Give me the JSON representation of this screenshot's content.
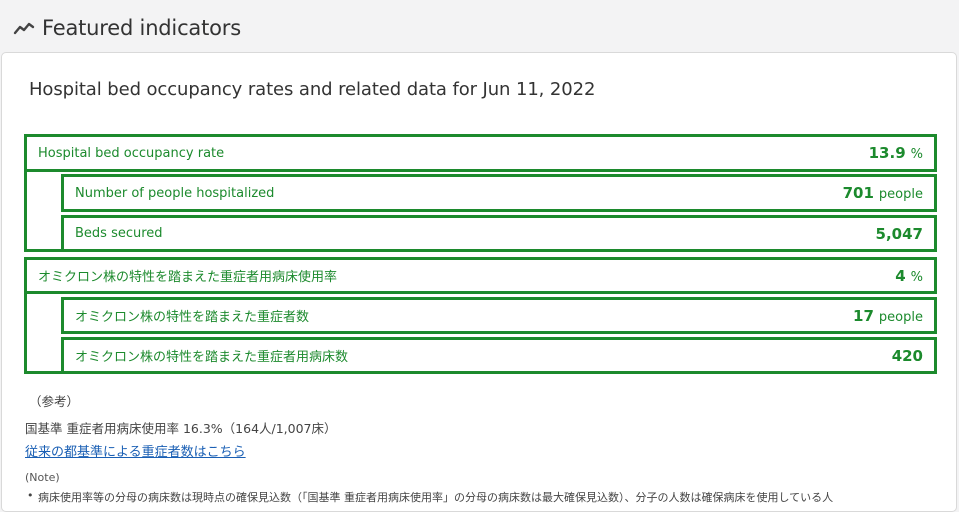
{
  "header": {
    "title": "Featured indicators",
    "icon": "trend-line-icon"
  },
  "card": {
    "title": "Hospital bed occupancy rates and related data for Jun 11, 2022",
    "group1": {
      "main": {
        "label": "Hospital bed occupancy rate",
        "value": "13.9",
        "unit": "%"
      },
      "sub1": {
        "label": "Number of people hospitalized",
        "value": "701",
        "unit": "people"
      },
      "sub2": {
        "label": "Beds secured",
        "value": "5,047",
        "unit": ""
      }
    },
    "group2": {
      "main": {
        "label": "オミクロン株の特性を踏まえた重症者用病床使用率",
        "value": "4",
        "unit": "%"
      },
      "sub1": {
        "label": "オミクロン株の特性を踏まえた重症者数",
        "value": "17",
        "unit": "people"
      },
      "sub2": {
        "label": "オミクロン株の特性を踏まえた重症者用病床数",
        "value": "420",
        "unit": ""
      }
    },
    "notes": {
      "ref_heading": "（参考）",
      "ref_line": "国基準 重症者用病床使用率 16.3%（164人/1,007床）",
      "link": "従来の都基準による重症者数はこちら",
      "note_heading": "(Note)",
      "note_item": "病床使用率等の分母の病床数は現時点の確保見込数（「国基準 重症者用病床使用率」の分母の病床数は最大確保見込数）、分子の人数は確保病床を使用している人"
    }
  },
  "colors": {
    "accent": "#1c8a2d",
    "link": "#1a5fb4"
  }
}
